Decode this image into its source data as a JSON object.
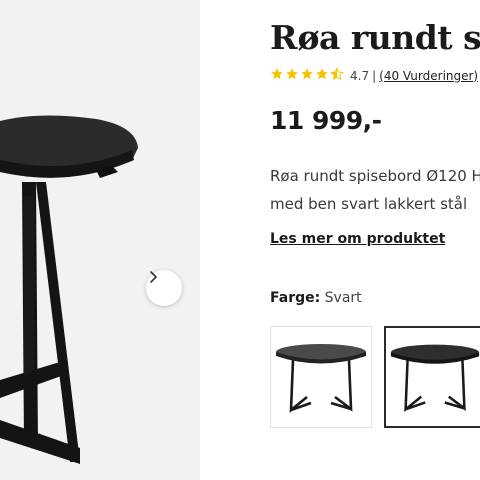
{
  "product": {
    "title": "Røa rundt spisebord",
    "rating_value": "4.7",
    "rating_separator": "|",
    "reviews_text": "(40 Vurderinger)",
    "stars_full": 4,
    "stars_half": 1,
    "price": "11 999,-",
    "description_line1": "Røa rundt spisebord Ø120 H",
    "description_line2": "med ben svart lakkert stål",
    "read_more": "Les mer om produktet",
    "color_label": "Farge:",
    "color_value": "Svart"
  },
  "colors": {
    "star": "#f5c400",
    "table": "#232323",
    "gallery_bg": "#f4f2f0"
  },
  "icons": {
    "next": "chevron-right-icon",
    "star": "star-icon"
  }
}
